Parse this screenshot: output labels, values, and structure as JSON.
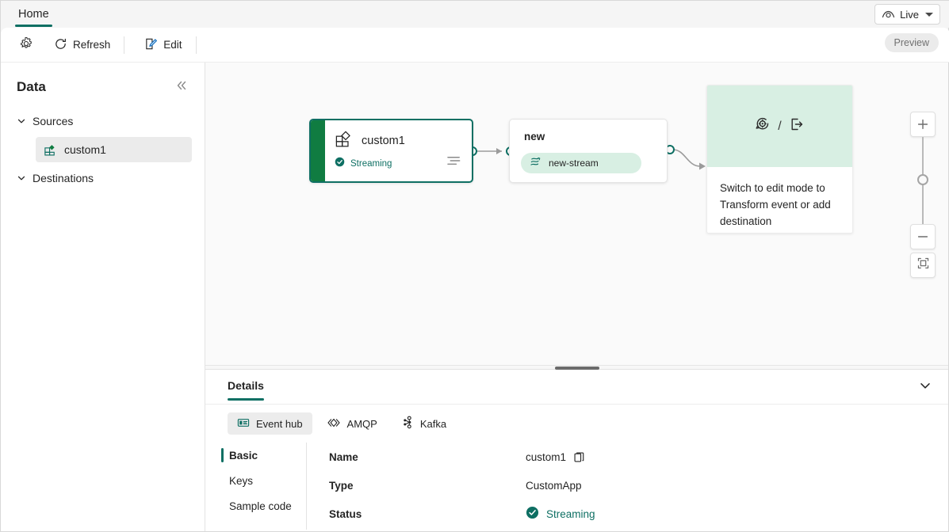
{
  "window": {
    "tabs": [
      {
        "label": "Home",
        "active": true
      }
    ],
    "live_control": {
      "label": "Live",
      "icon": "live-eye-icon"
    }
  },
  "toolbar": {
    "settings_label": "",
    "settings_icon": "gear-icon",
    "refresh_label": "Refresh",
    "refresh_icon": "refresh-icon",
    "edit_label": "Edit",
    "edit_icon": "edit-pencil-icon",
    "preview_label": "Preview"
  },
  "sidebar": {
    "title": "Data",
    "collapse_icon": "double-chevron-left-icon",
    "groups": [
      {
        "label": "Sources",
        "expanded": true,
        "items": [
          {
            "label": "custom1",
            "icon": "custom-app-icon",
            "selected": true
          }
        ]
      },
      {
        "label": "Destinations",
        "expanded": true,
        "items": []
      }
    ]
  },
  "canvas": {
    "nodes": [
      {
        "id": "custom1",
        "title": "custom1",
        "icon": "custom-app-icon",
        "status": "Streaming",
        "status_icon": "check-circle-icon",
        "menu_icon": "list-menu-icon",
        "selected": true
      },
      {
        "id": "new",
        "title": "new",
        "stream": {
          "label": "new-stream",
          "icon": "eventstream-icon"
        }
      },
      {
        "id": "hint",
        "icon_left": "transform-event-icon",
        "separator": "/",
        "icon_right": "add-destination-icon",
        "text": "Switch to edit mode to Transform event or add destination"
      }
    ],
    "zoom_controls": {
      "zoom_in_label": "+",
      "zoom_out_label": "−",
      "fit_icon": "fit-to-screen-icon"
    }
  },
  "details": {
    "tab_label": "Details",
    "collapse_icon": "chevron-down-icon",
    "protocol_tabs": [
      {
        "label": "Event hub",
        "icon": "event-hub-icon",
        "selected": true
      },
      {
        "label": "AMQP",
        "icon": "amqp-icon",
        "selected": false
      },
      {
        "label": "Kafka",
        "icon": "kafka-icon",
        "selected": false
      }
    ],
    "sub_nav": [
      {
        "label": "Basic",
        "selected": true
      },
      {
        "label": "Keys",
        "selected": false
      },
      {
        "label": "Sample code",
        "selected": false
      }
    ],
    "fields": [
      {
        "key": "Name",
        "value": "custom1",
        "copy": true
      },
      {
        "key": "Type",
        "value": "CustomApp",
        "copy": false
      },
      {
        "key": "Status",
        "value": "Streaming",
        "status": true
      }
    ]
  },
  "colors": {
    "accent_teal": "#0e6f63",
    "accent_green": "#107c41",
    "chip_green": "#d8efe3",
    "canvas_bg": "#fafafa"
  }
}
